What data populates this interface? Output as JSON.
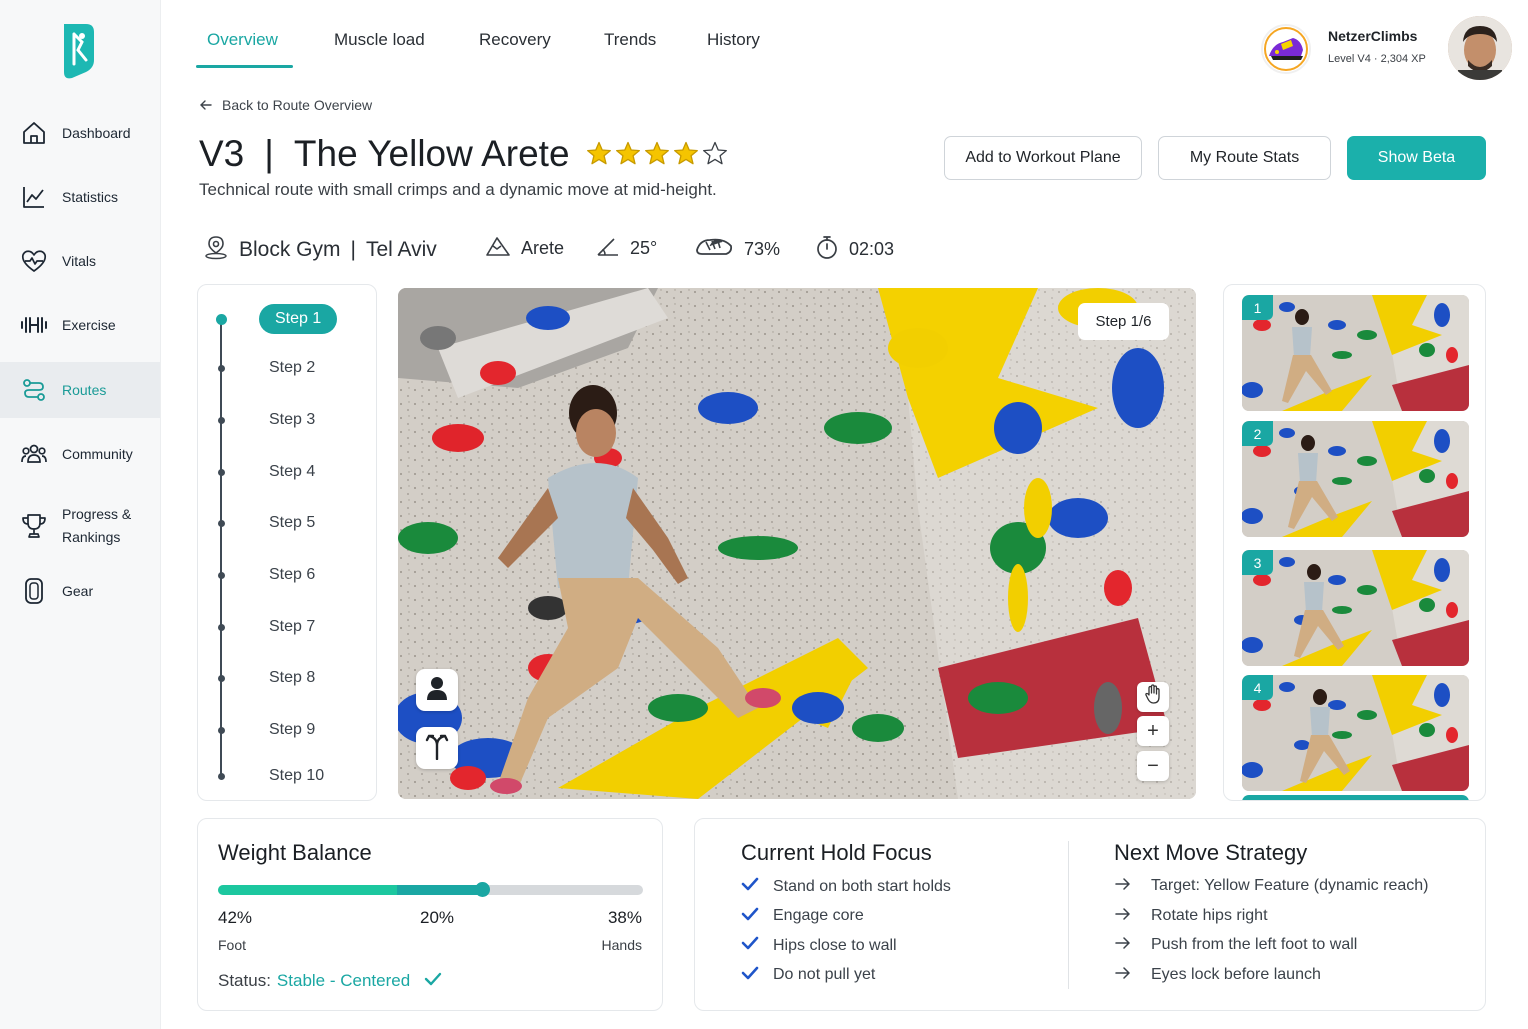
{
  "sidebar": {
    "items": [
      {
        "label": "Dashboard",
        "icon": "home-icon"
      },
      {
        "label": "Statistics",
        "icon": "chart-line-icon"
      },
      {
        "label": "Vitals",
        "icon": "heart-pulse-icon"
      },
      {
        "label": "Exercise",
        "icon": "dumbbell-icon"
      },
      {
        "label": "Routes",
        "icon": "route-icon",
        "active": true
      },
      {
        "label": "Community",
        "icon": "users-icon"
      },
      {
        "label": "Progress & Rankings",
        "icon": "trophy-icon"
      },
      {
        "label": "Gear",
        "icon": "gear-shoe-icon"
      }
    ]
  },
  "tabs": [
    {
      "label": "Overview",
      "active": true
    },
    {
      "label": "Muscle load"
    },
    {
      "label": "Recovery"
    },
    {
      "label": "Trends"
    },
    {
      "label": "History"
    }
  ],
  "profile": {
    "name": "NetzerClimbs",
    "level": "Level V4",
    "xp": "2,304 XP"
  },
  "back_link": "Back to Route Overview",
  "route": {
    "grade": "V3",
    "separator": "|",
    "name": "The Yellow Arete",
    "rating": 4,
    "rating_max": 5,
    "description": "Technical route with small crimps and a dynamic move at mid-height."
  },
  "actions": {
    "add_workout": "Add to Workout Plane",
    "route_stats": "My Route Stats",
    "show_beta": "Show Beta"
  },
  "meta": {
    "gym": "Block Gym",
    "city": "Tel Aviv",
    "gym_separator": "|",
    "type": "Arete",
    "angle": "25°",
    "success": "73%",
    "time": "02:03"
  },
  "steps": [
    "Step 1",
    "Step 2",
    "Step 3",
    "Step 4",
    "Step 5",
    "Step 6",
    "Step 7",
    "Step 8",
    "Step 9",
    "Step 10"
  ],
  "active_step": 0,
  "viewer": {
    "step_chip": "Step 1/6",
    "zoom_in": "+",
    "zoom_out": "−"
  },
  "thumbnails": [
    "1",
    "2",
    "3",
    "4"
  ],
  "weight_balance": {
    "title": "Weight Balance",
    "foot_pct": 42,
    "mid_pct": 20,
    "hands_pct": 38,
    "foot_value": "42%",
    "mid_value": "20%",
    "hands_value": "38%",
    "foot_label": "Foot",
    "hands_label": "Hands",
    "status_label": "Status:",
    "status_value": "Stable - Centered",
    "colors": {
      "foot": "#1cc79f",
      "mid": "#1aa7a3",
      "rest": "#d6d9dc"
    }
  },
  "hold_focus": {
    "title": "Current Hold Focus",
    "items": [
      "Stand on both start holds",
      "Engage core",
      "Hips close to wall",
      "Do not pull yet"
    ]
  },
  "next_move": {
    "title": "Next Move Strategy",
    "items": [
      "Target: Yellow Feature (dynamic reach)",
      "Rotate hips right",
      "Push from the left foot to wall",
      "Eyes lock before launch"
    ]
  },
  "colors": {
    "accent": "#1aa7a3",
    "star": "#f5c400"
  }
}
